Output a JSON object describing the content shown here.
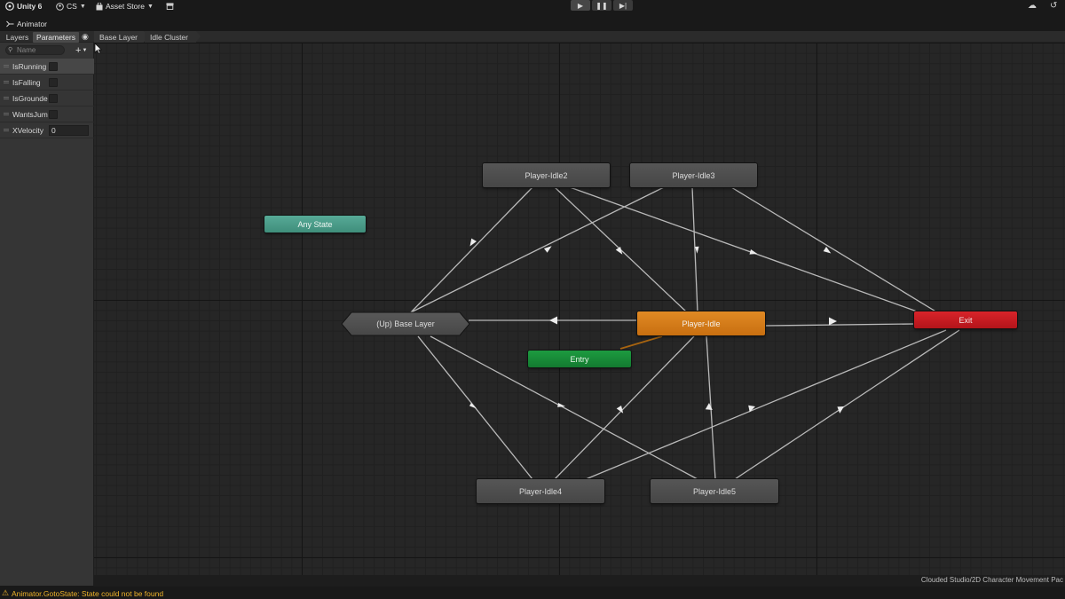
{
  "toolbar": {
    "unity_label": "Unity 6",
    "account_label": "CS",
    "asset_store_label": "Asset Store",
    "icons": [
      "unity-logo-icon",
      "account-icon",
      "shopping-bag-icon",
      "package-icon",
      "play-icon",
      "pause-icon",
      "step-icon",
      "cloud-icon",
      "history-icon"
    ]
  },
  "window": {
    "tab_label": "Animator"
  },
  "subbar": {
    "layers_tab": "Layers",
    "parameters_tab": "Parameters",
    "breadcrumbs": [
      "Base Layer",
      "Idle Cluster"
    ]
  },
  "parameters": {
    "search_placeholder": "Name",
    "items": [
      {
        "name": "IsRunning",
        "type": "bool"
      },
      {
        "name": "IsFalling",
        "type": "bool"
      },
      {
        "name": "IsGrounde",
        "type": "bool"
      },
      {
        "name": "WantsJum",
        "type": "bool"
      },
      {
        "name": "XVelocity",
        "type": "float",
        "value": "0"
      }
    ]
  },
  "graph": {
    "states": {
      "idle2": "Player-Idle2",
      "idle3": "Player-Idle3",
      "any_state": "Any State",
      "up_base": "(Up) Base Layer",
      "idle": "Player-Idle",
      "exit": "Exit",
      "entry": "Entry",
      "idle4": "Player-Idle4",
      "idle5": "Player-Idle5"
    },
    "default_state": "Player-Idle"
  },
  "footer": {
    "asset_path": "Clouded Studio/2D Character Movement Pac",
    "status_message": "Animator.GotoState: State could not be found"
  },
  "colors": {
    "default_state": "#d87c1a",
    "entry": "#1a8a38",
    "any_state": "#4f9e8b",
    "exit": "#c81c22",
    "warning": "#f0b429"
  }
}
